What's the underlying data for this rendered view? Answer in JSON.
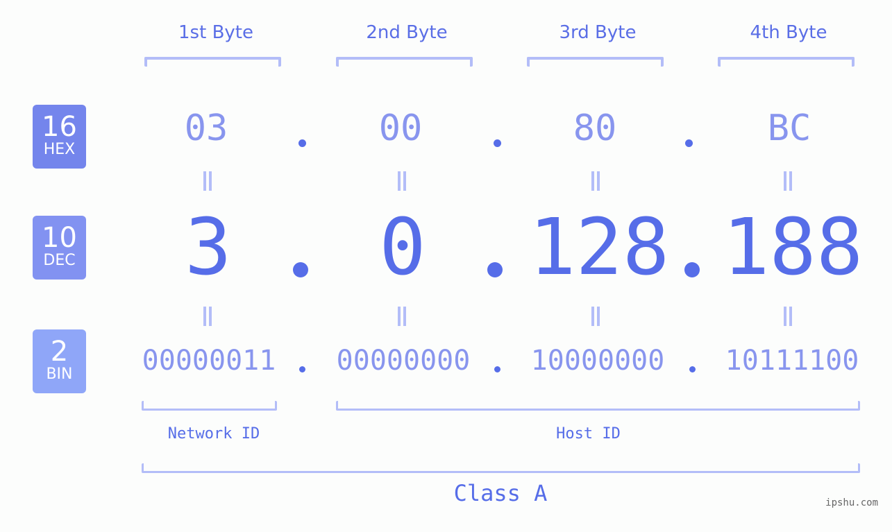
{
  "colors": {
    "accent": "#566de8",
    "light_accent": "#8895ee",
    "bracket": "#b3bdf8",
    "hex_badge": "#7485ec",
    "dec_badge": "#8292f1",
    "bin_badge": "#8fa6f8",
    "background": "#fcfdfc"
  },
  "byte_headers": [
    "1st Byte",
    "2nd Byte",
    "3rd Byte",
    "4th Byte"
  ],
  "badges": {
    "hex": {
      "num": "16",
      "label": "HEX"
    },
    "dec": {
      "num": "10",
      "label": "DEC"
    },
    "bin": {
      "num": "2",
      "label": "BIN"
    }
  },
  "hex": [
    "03",
    "00",
    "80",
    "BC"
  ],
  "dec": [
    "3",
    "0",
    "128",
    "188"
  ],
  "bin": [
    "00000011",
    "00000000",
    "10000000",
    "10111100"
  ],
  "network_label": "Network ID",
  "host_label": "Host ID",
  "class_label": "Class A",
  "watermark": "ipshu.com"
}
